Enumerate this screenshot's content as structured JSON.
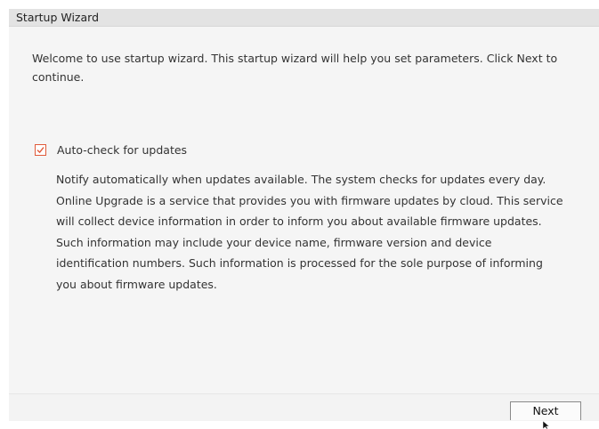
{
  "window": {
    "title": "Startup Wizard"
  },
  "content": {
    "welcome": "Welcome to use startup wizard. This startup wizard will help you set parameters. Click Next to continue.",
    "auto_check_label": "Auto-check for updates",
    "auto_check_checked": true,
    "description": [
      "Notify automatically when updates available. The system checks for updates every day.",
      "Online Upgrade is a service that provides you with firmware updates by cloud. This service",
      "will collect device information in order to inform you about available firmware updates.",
      "Such information may include your device name, firmware version and device",
      "identification numbers. Such information is processed for the sole purpose of informing",
      "you about firmware updates."
    ]
  },
  "footer": {
    "next_label": "Next"
  },
  "colors": {
    "accent": "#e05a3a",
    "titlebar": "#e3e3e3",
    "background": "#f5f5f5"
  },
  "icons": {
    "checkbox": "checkmark-icon",
    "cursor": "mouse-pointer-icon"
  }
}
